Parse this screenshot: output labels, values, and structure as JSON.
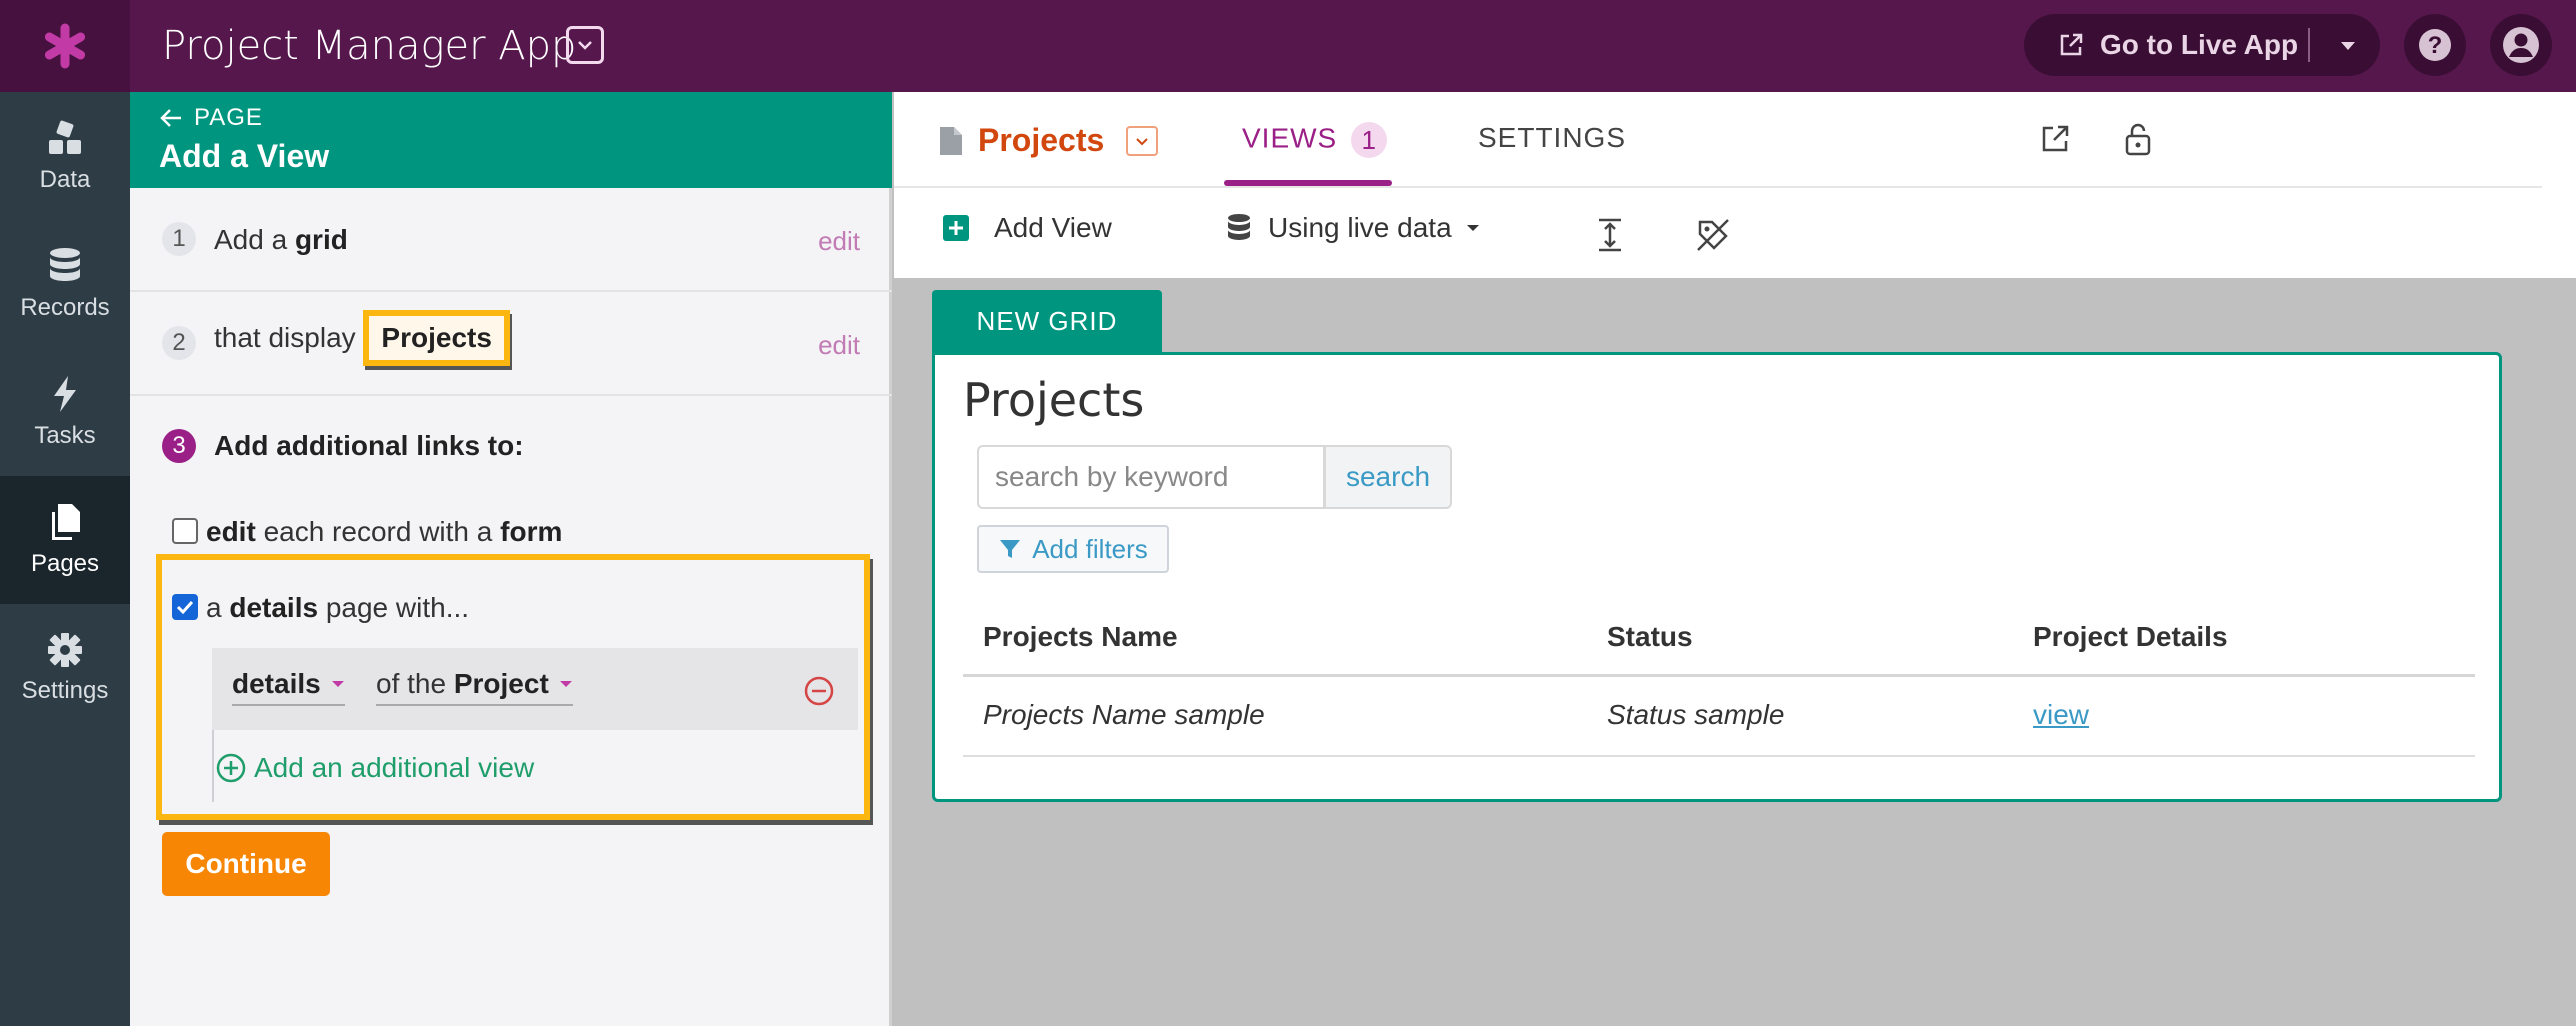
{
  "app": {
    "title": "Project Manager App"
  },
  "topbar": {
    "live_app_label": "Go to Live App"
  },
  "leftnav": [
    {
      "label": "Data",
      "icon": "data-icon"
    },
    {
      "label": "Records",
      "icon": "database-icon"
    },
    {
      "label": "Tasks",
      "icon": "bolt-icon"
    },
    {
      "label": "Pages",
      "icon": "pages-icon",
      "active": true
    },
    {
      "label": "Settings",
      "icon": "gear-icon"
    }
  ],
  "builder": {
    "back_label": "PAGE",
    "title": "Add a View",
    "step1": {
      "num": "1",
      "prefix": "Add a",
      "strong": "grid",
      "edit": "edit"
    },
    "step2": {
      "num": "2",
      "prefix": "that display",
      "strong": "Projects",
      "edit": "edit"
    },
    "step3": {
      "num": "3",
      "label": "Add additional links to:"
    },
    "option_edit": {
      "w1": "edit",
      "w2": "each record with a",
      "w3": "form",
      "checked": false
    },
    "option_details": {
      "w1": "a",
      "w2": "details",
      "w3": "page with...",
      "checked": true
    },
    "details_select": "details",
    "of_the_prefix": "of the",
    "of_the_value": "Project",
    "add_additional_view": "Add an additional view",
    "continue": "Continue"
  },
  "main": {
    "page_name": "Projects",
    "tabs": {
      "views": "VIEWS",
      "views_count": "1",
      "settings": "SETTINGS"
    },
    "toolbar": {
      "add_view": "Add View",
      "data_source": "Using live data"
    }
  },
  "grid": {
    "tab_label": "NEW GRID",
    "title": "Projects",
    "search_placeholder": "search by keyword",
    "search_button": "search",
    "add_filters": "Add filters",
    "columns": [
      "Projects Name",
      "Status",
      "Project Details"
    ],
    "rows": [
      [
        "Projects Name sample",
        "Status sample",
        "view"
      ]
    ]
  },
  "colors": {
    "topbar": "#56174d",
    "accent_teal": "#00957f",
    "accent_purple": "#9a1f86",
    "highlight": "#fbb70f",
    "continue": "#f78604",
    "page_orange": "#d1470d"
  }
}
